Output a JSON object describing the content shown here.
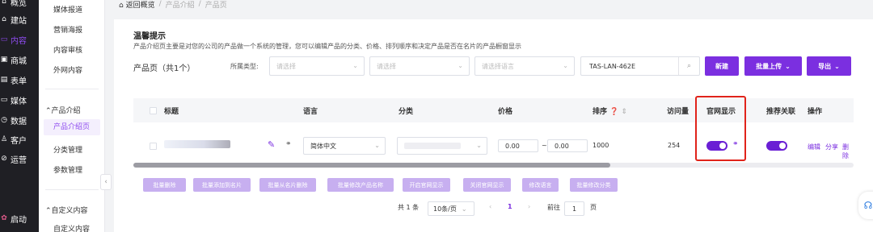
{
  "nav_primary": [
    {
      "label": "概览",
      "icon": "home-icon"
    },
    {
      "label": "建站",
      "icon": "site-icon"
    },
    {
      "label": "内容",
      "icon": "file-icon",
      "active": true
    },
    {
      "label": "商城",
      "icon": "cart-icon"
    },
    {
      "label": "表单",
      "icon": "form-icon"
    },
    {
      "label": "媒体",
      "icon": "media-icon"
    },
    {
      "label": "数据",
      "icon": "chart-icon"
    },
    {
      "label": "客户",
      "icon": "user-icon"
    },
    {
      "label": "运营",
      "icon": "tag-icon"
    },
    {
      "label": "启动",
      "icon": "launch-icon"
    }
  ],
  "nav_secondary": {
    "items_top": [
      "媒体报道",
      "营销海报",
      "内容审核",
      "外网内容"
    ],
    "group_product": "产品介绍",
    "product_items": [
      "产品介绍页",
      "分类管理",
      "参数管理"
    ],
    "group_custom": "自定义内容",
    "custom_items": [
      "自定义内容"
    ]
  },
  "breadcrumb": {
    "back": "返回概览",
    "level1": "产品介绍",
    "level2": "产品页",
    "sep": "/"
  },
  "tip": {
    "title": "温馨提示",
    "desc": "产品介绍页主要是对您的公司的产品做一个系统的管理，您可以编辑产品的分类、价格、排列顺序和决定产品是否在名片的产品橱窗显示"
  },
  "page_count": "产品页（共1个）",
  "filters": {
    "type_label": "所属类型:",
    "type_placeholder": "请选择",
    "select2_placeholder": "请选择",
    "lang_placeholder": "请选择语言",
    "search_value": "TAS-LAN-462E"
  },
  "buttons": {
    "new": "新建",
    "batch_upload": "批量上传",
    "export": "导出"
  },
  "columns": [
    "标题",
    "语言",
    "分类",
    "价格",
    "排序",
    "访问量",
    "官网显示",
    "推荐关联",
    "操作"
  ],
  "row": {
    "language": "简体中文",
    "price_min": "0.00",
    "price_sep": "~",
    "price_max": "0.00",
    "sort": "1000",
    "visits": "254",
    "site_display": true,
    "recommend": true,
    "ops": [
      "编辑",
      "分享",
      "删除"
    ]
  },
  "batch_buttons": [
    "批量删除",
    "批量添加到名片",
    "批量从名片删除",
    "批量修改产品名称",
    "开启官网显示",
    "关闭官网显示",
    "修改语言",
    "批量修改分类"
  ],
  "pagination": {
    "total": "共 1 条",
    "page_size": "10条/页",
    "prev": "‹",
    "current": "1",
    "next": "›",
    "goto_label": "前往",
    "goto_value": "1",
    "page_suffix": "页"
  },
  "colors": {
    "accent": "#7b2fe0",
    "highlight_border": "#e0231a",
    "batch_btn": "#c7aff0"
  }
}
